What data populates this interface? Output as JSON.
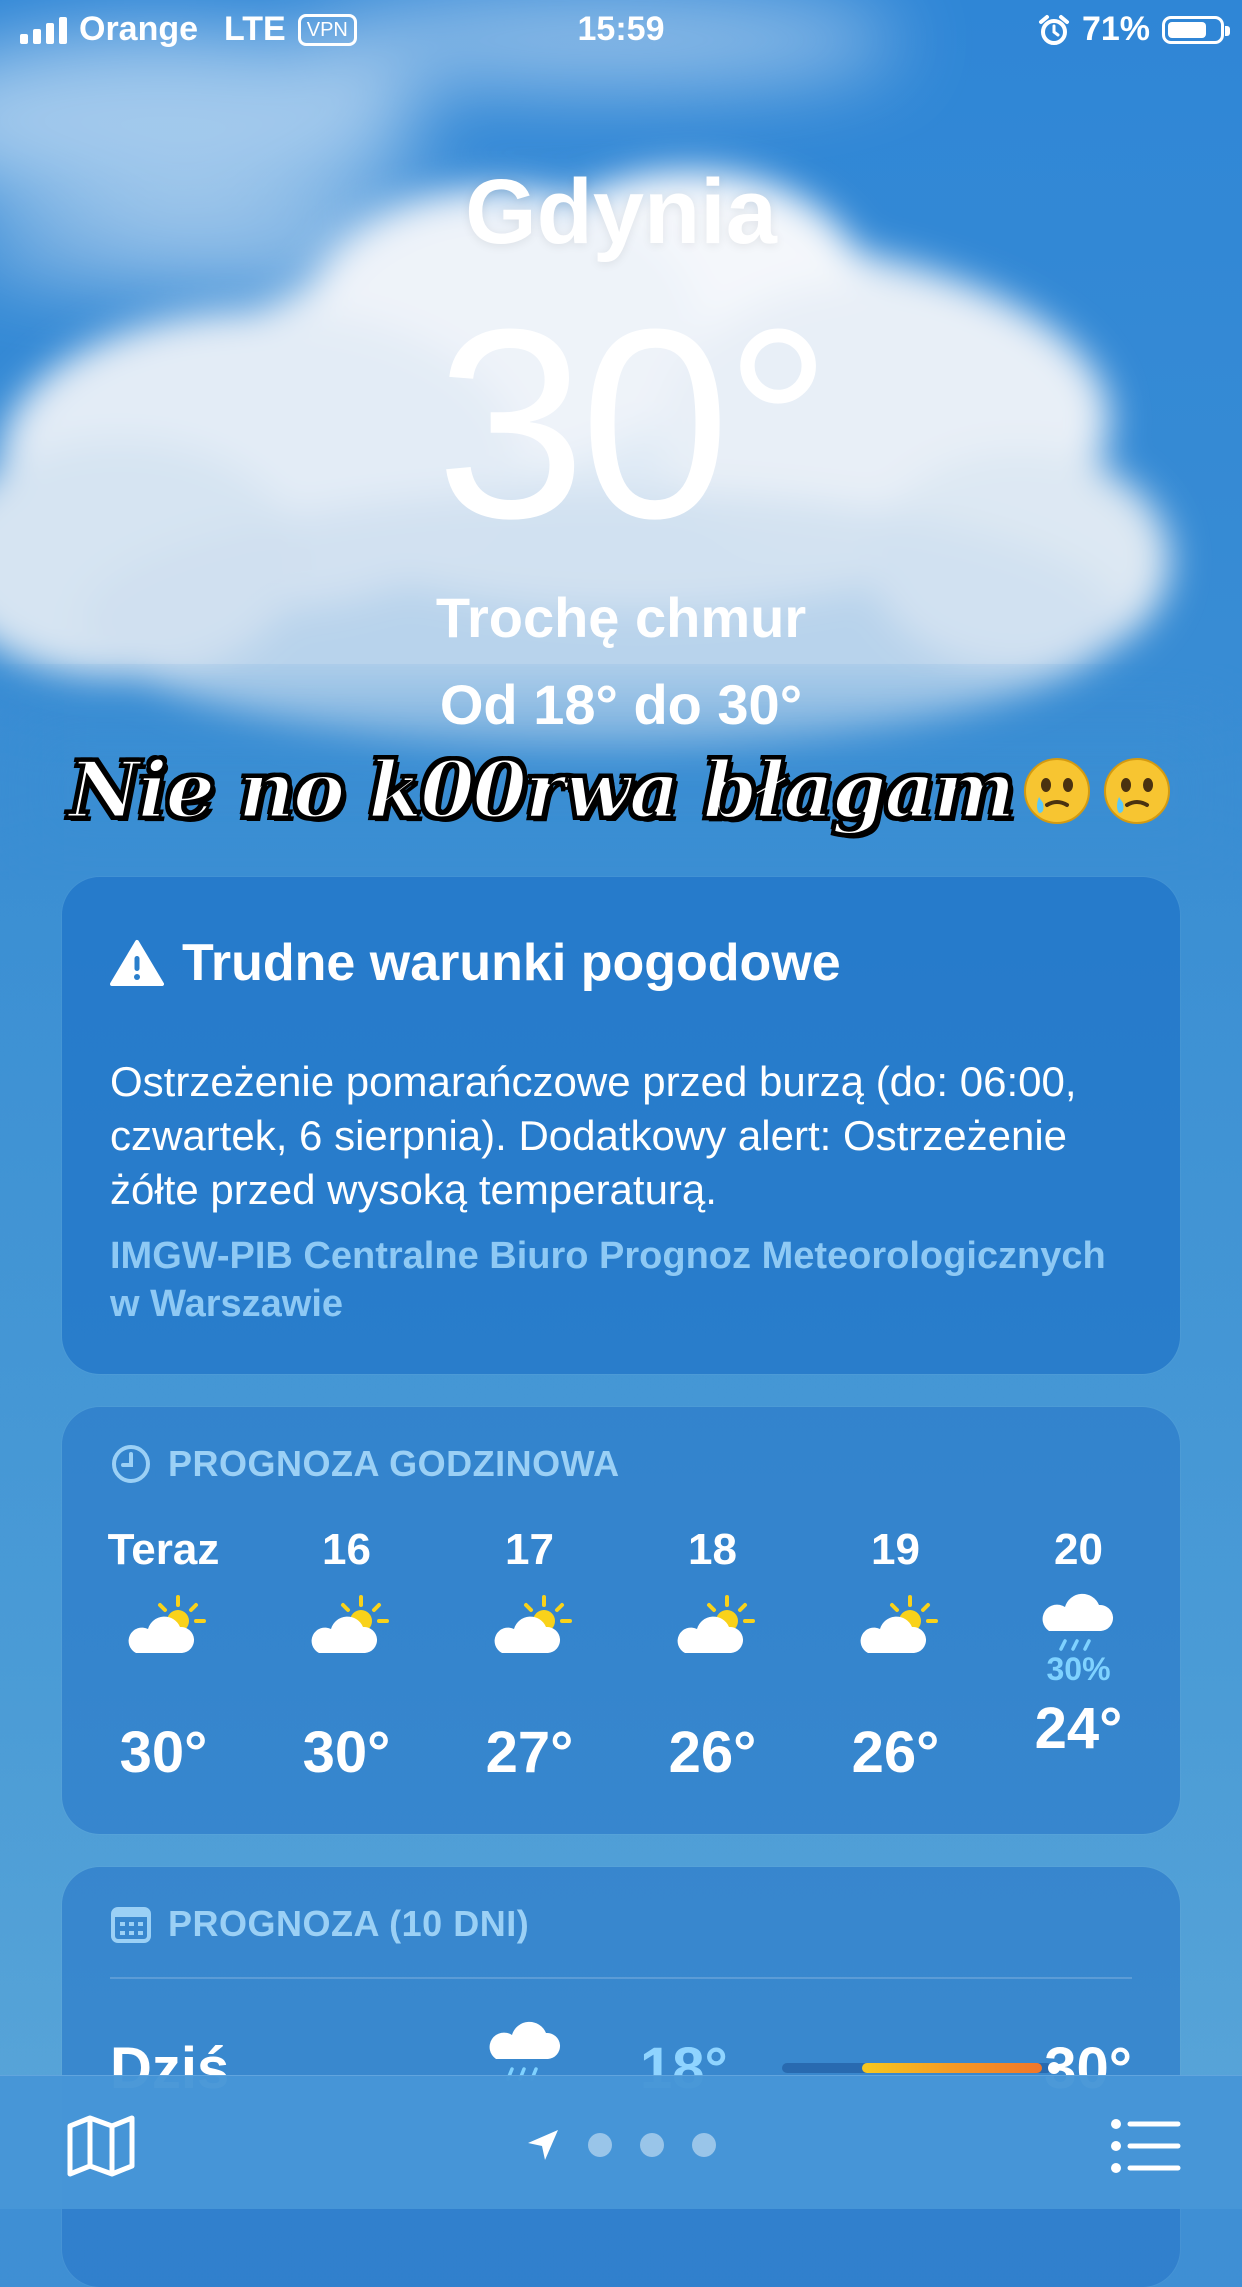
{
  "status_bar": {
    "carrier": "Orange",
    "network": "LTE",
    "vpn": "VPN",
    "time": "15:59",
    "battery": "71%",
    "battery_level": 0.71,
    "icons": [
      "signal-icon",
      "alarm-icon",
      "battery-icon"
    ]
  },
  "hero": {
    "city": "Gdynia",
    "temperature": "30°",
    "condition": "Trochę chmur",
    "range": "Od 18°  do 30°",
    "caption": "Nie no k00rwa błagam",
    "caption_emoji": [
      "face-holding-back-tears-emoji",
      "face-holding-back-tears-emoji"
    ]
  },
  "alert": {
    "icon": "warning-icon",
    "title": "Trudne warunki pogodowe",
    "body": "Ostrzeżenie pomarańczowe przed burzą (do: 06:00, czwartek, 6 sierpnia). Dodatkowy alert: Ostrzeżenie żółte przed wysoką temperaturą.",
    "source": "IMGW-PIB Centralne Biuro Prognoz Meteorologicznych w Warszawie"
  },
  "hourly": {
    "header": "PROGNOZA GODZINOWA",
    "icon": "clock-icon",
    "hours": [
      {
        "label": "Teraz",
        "icon": "partly-sunny-icon",
        "precip": "",
        "temp": "30°"
      },
      {
        "label": "16",
        "icon": "partly-sunny-icon",
        "precip": "",
        "temp": "30°"
      },
      {
        "label": "17",
        "icon": "partly-sunny-icon",
        "precip": "",
        "temp": "27°"
      },
      {
        "label": "18",
        "icon": "partly-sunny-icon",
        "precip": "",
        "temp": "26°"
      },
      {
        "label": "19",
        "icon": "partly-sunny-icon",
        "precip": "",
        "temp": "26°"
      },
      {
        "label": "20",
        "icon": "rain-cloud-icon",
        "precip": "30%",
        "temp": "24°"
      }
    ]
  },
  "daily": {
    "header": "PROGNOZA (10 DNI)",
    "icon": "calendar-icon",
    "days": [
      {
        "label": "Dziś",
        "icon": "rain-cloud-icon",
        "low": "18°",
        "high": "30°"
      }
    ]
  },
  "tabbar": {
    "icons": [
      "map-icon",
      "location-arrow-icon",
      "list-icon"
    ],
    "pages": 3
  },
  "colors": {
    "precip": "#7fd2ff",
    "alert_source": "#8ec9f4",
    "section_header": "#9bd0f5",
    "temp_bar": [
      "#f7c81f",
      "#f0762a"
    ]
  }
}
